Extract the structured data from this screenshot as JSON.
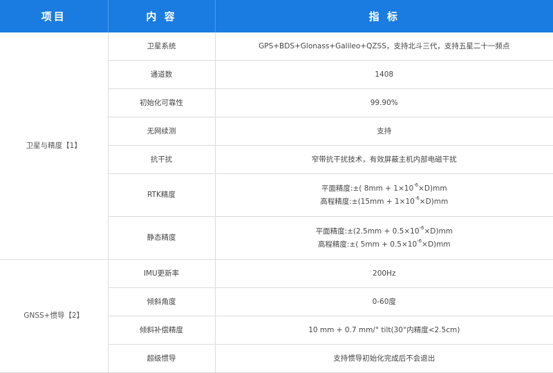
{
  "header": {
    "col1": "项目",
    "col2": "内 容",
    "col3": "指 标"
  },
  "groups": [
    {
      "name": "卫星与精度【1】",
      "rows": [
        {
          "item": "卫星系统",
          "value": "GPS+BDS+Glonass+Galileo+QZSS，支持北斗三代，支持五星二十一频点"
        },
        {
          "item": "通道数",
          "value": "1408"
        },
        {
          "item": "初始化可靠性",
          "value": "99.90%"
        },
        {
          "item": "无网续测",
          "value": "支持"
        },
        {
          "item": "抗干扰",
          "value": "窄带抗干扰技术，有效屏蔽主机内部电磁干扰"
        },
        {
          "item": "RTK精度",
          "line1": {
            "prefix": "平面精度:±( 8mm + 1×10",
            "exp": "-6",
            "suffix": "×D)mm"
          },
          "line2": {
            "prefix": "高程精度:±(15mm + 1×10",
            "exp": "-6",
            "suffix": "×D)mm"
          }
        },
        {
          "item": "静态精度",
          "line1": {
            "prefix": "平面精度:±(2.5mm + 0.5×10",
            "exp": "-6",
            "suffix": "×D)mm"
          },
          "line2": {
            "prefix": "高程精度:±( 5mm + 0.5×10",
            "exp": "-6",
            "suffix": "×D)mm"
          }
        }
      ]
    },
    {
      "name": "GNSS+惯导【2】",
      "rows": [
        {
          "item": "IMU更新率",
          "value": "200Hz"
        },
        {
          "item": "倾斜角度",
          "value": "0-60度"
        },
        {
          "item": "倾斜补偿精度",
          "value": "10 mm + 0.7 mm/° tilt(30°内精度<2.5cm)"
        },
        {
          "item": "超级惯导",
          "value": "支持惯导初始化完成后不会退出"
        }
      ]
    }
  ]
}
